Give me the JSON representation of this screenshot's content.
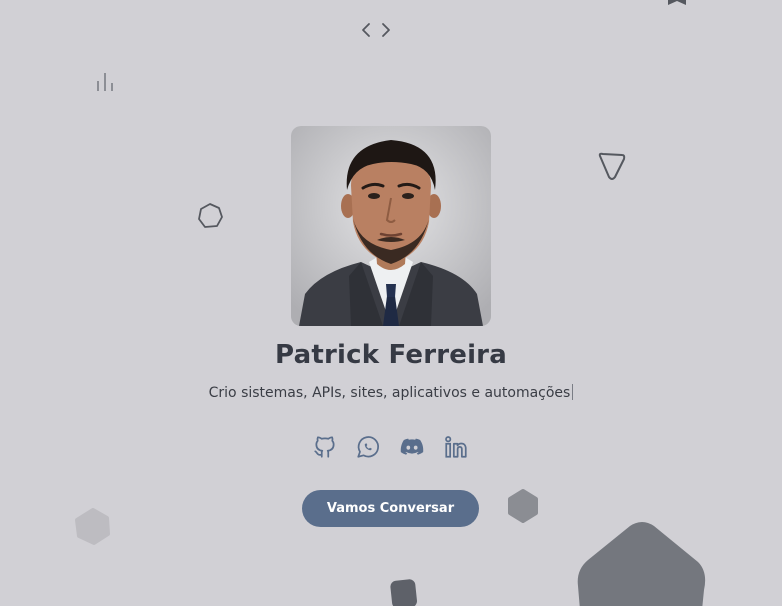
{
  "profile": {
    "name": "Patrick Ferreira",
    "tagline": "Crio sistemas, APIs, sites, aplicativos e automações"
  },
  "photo": {
    "alt": "Patrick Ferreira"
  },
  "socials": [
    {
      "name": "github",
      "icon": "github-icon"
    },
    {
      "name": "whatsapp",
      "icon": "whatsapp-icon"
    },
    {
      "name": "discord",
      "icon": "discord-icon"
    },
    {
      "name": "linkedin",
      "icon": "linkedin-icon"
    }
  ],
  "cta": {
    "label": "Vamos Conversar"
  },
  "colors": {
    "background": "#d1d0d5",
    "accent": "#5a6e8c",
    "text": "#363a44",
    "icon": "#5a6e8c"
  }
}
